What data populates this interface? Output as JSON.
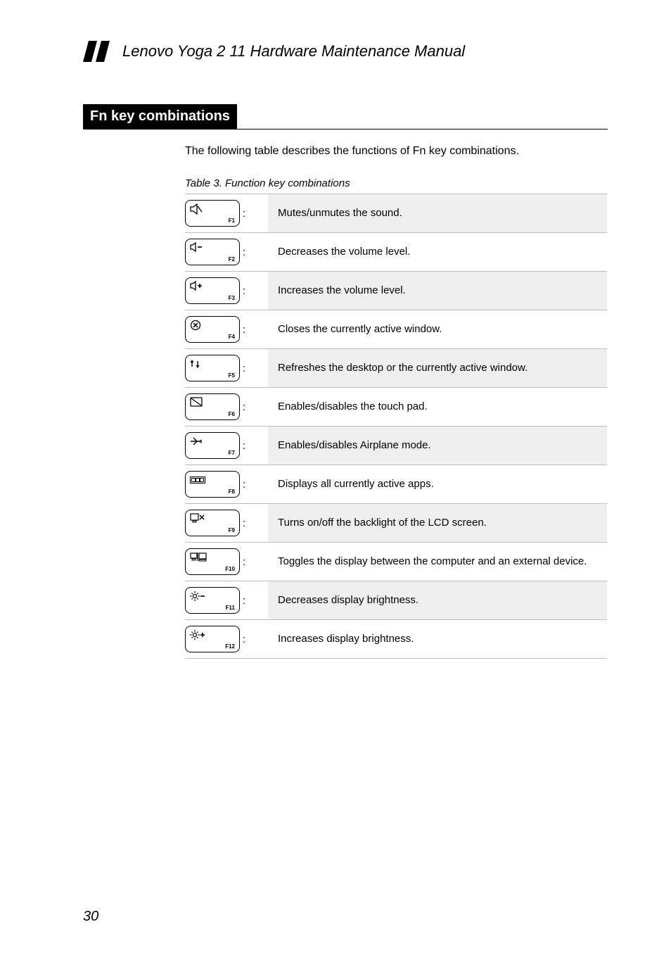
{
  "doc_title": "Lenovo Yoga 2 11 Hardware Maintenance Manual",
  "section_heading": "Fn key combinations",
  "intro_text": "The following table describes the functions of Fn key combinations.",
  "table_caption": "Table 3. Function key combinations",
  "page_number": "30",
  "rows": [
    {
      "fn": "F1",
      "icon": "mute-icon",
      "desc": "Mutes/unmutes the sound."
    },
    {
      "fn": "F2",
      "icon": "volume-down-icon",
      "desc": "Decreases the volume level."
    },
    {
      "fn": "F3",
      "icon": "volume-up-icon",
      "desc": "Increases the volume level."
    },
    {
      "fn": "F4",
      "icon": "close-window-icon",
      "desc": "Closes the currently active window."
    },
    {
      "fn": "F5",
      "icon": "refresh-icon",
      "desc": "Refreshes the desktop or the currently active window."
    },
    {
      "fn": "F6",
      "icon": "touchpad-icon",
      "desc": "Enables/disables the touch pad."
    },
    {
      "fn": "F7",
      "icon": "airplane-icon",
      "desc": "Enables/disables Airplane mode."
    },
    {
      "fn": "F8",
      "icon": "active-apps-icon",
      "desc": "Displays all currently active apps."
    },
    {
      "fn": "F9",
      "icon": "backlight-off-icon",
      "desc": "Turns on/off the backlight of the LCD screen."
    },
    {
      "fn": "F10",
      "icon": "display-toggle-icon",
      "desc": "Toggles the display between the computer and an external device."
    },
    {
      "fn": "F11",
      "icon": "brightness-down-icon",
      "desc": "Decreases display brightness."
    },
    {
      "fn": "F12",
      "icon": "brightness-up-icon",
      "desc": "Increases display brightness."
    }
  ]
}
